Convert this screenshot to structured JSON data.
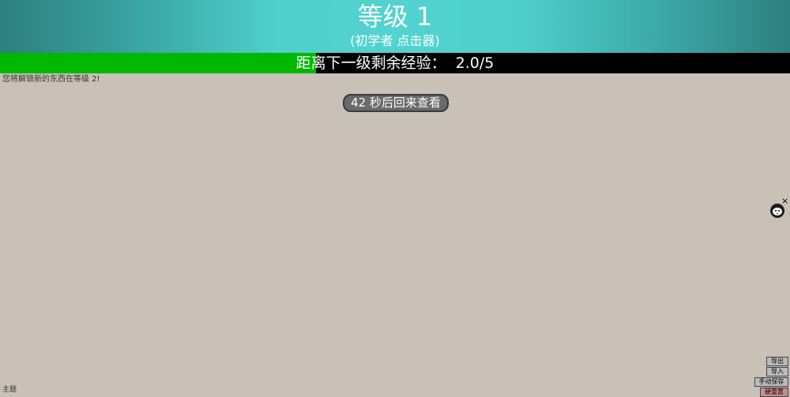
{
  "header": {
    "title": "等级 1",
    "subtitle": "(初学者 点击器)"
  },
  "xp": {
    "label": "距离下一级剩余经验：  2.0/5",
    "progress_fraction": 0.4,
    "fill_color": "#00b800"
  },
  "unlock_note": "您将解锁新的东西在等级 2!",
  "comeback_label": "42 秒后回来查看",
  "mascot": {
    "icon": "cat-face-icon",
    "close_label": "×"
  },
  "save_buttons": {
    "export": "导出",
    "import": "导入",
    "manual_save": "手动保存",
    "hard_reset": "硬重置"
  },
  "theme_label": "主题",
  "colors": {
    "background": "#c9c0b8",
    "header_accent": "#52d3cf",
    "xp_track": "#000000"
  }
}
